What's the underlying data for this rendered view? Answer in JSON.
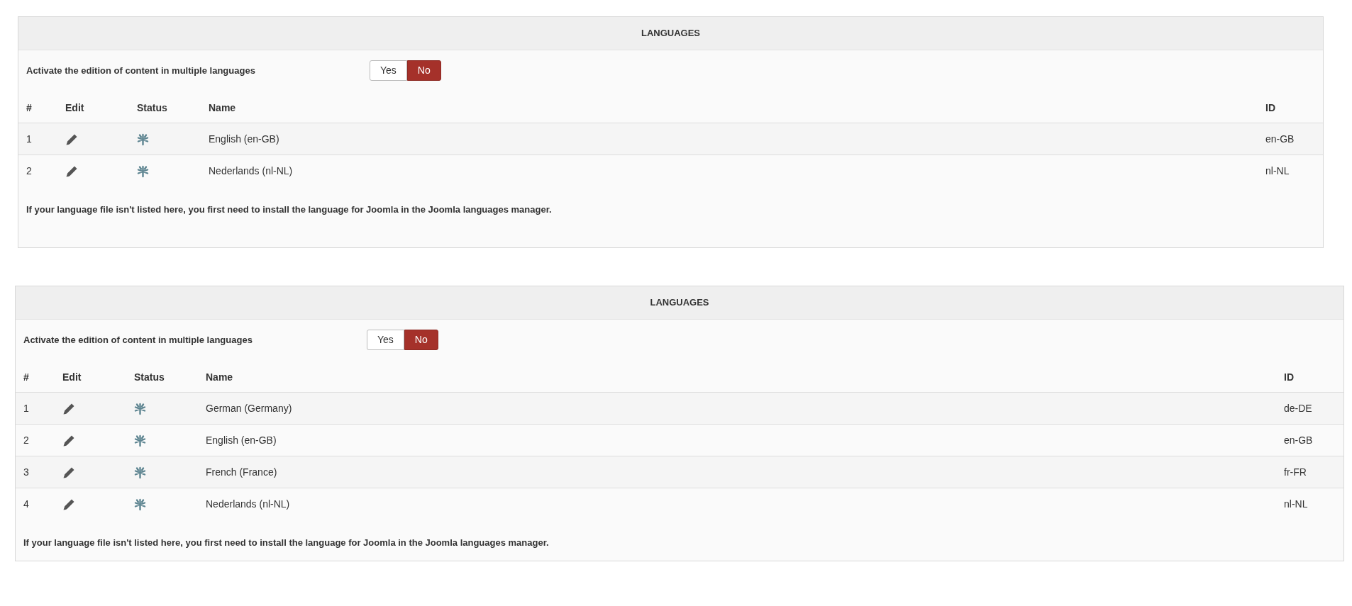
{
  "panels": [
    {
      "title": "LANGUAGES",
      "setting": {
        "label": "Activate the edition of content in multiple languages",
        "options": [
          {
            "label": "Yes",
            "selected": false
          },
          {
            "label": "No",
            "selected": true
          }
        ]
      },
      "columns": [
        "#",
        "Edit",
        "Status",
        "Name",
        "ID"
      ],
      "rows": [
        {
          "number": "1",
          "name": "English (en-GB)",
          "id": "en-GB"
        },
        {
          "number": "2",
          "name": "Nederlands (nl-NL)",
          "id": "nl-NL"
        }
      ],
      "note": "If your language file isn't listed here, you first need to install the language for Joomla in the Joomla languages manager."
    },
    {
      "title": "LANGUAGES",
      "setting": {
        "label": "Activate the edition of content in multiple languages",
        "options": [
          {
            "label": "Yes",
            "selected": false
          },
          {
            "label": "No",
            "selected": true
          }
        ]
      },
      "columns": [
        "#",
        "Edit",
        "Status",
        "Name",
        "ID"
      ],
      "rows": [
        {
          "number": "1",
          "name": "German (Germany)",
          "id": "de-DE"
        },
        {
          "number": "2",
          "name": "English (en-GB)",
          "id": "en-GB"
        },
        {
          "number": "3",
          "name": "French (France)",
          "id": "fr-FR"
        },
        {
          "number": "4",
          "name": "Nederlands (nl-NL)",
          "id": "nl-NL"
        }
      ],
      "note": "If your language file isn't listed here, you first need to install the language for Joomla in the Joomla languages manager."
    }
  ]
}
